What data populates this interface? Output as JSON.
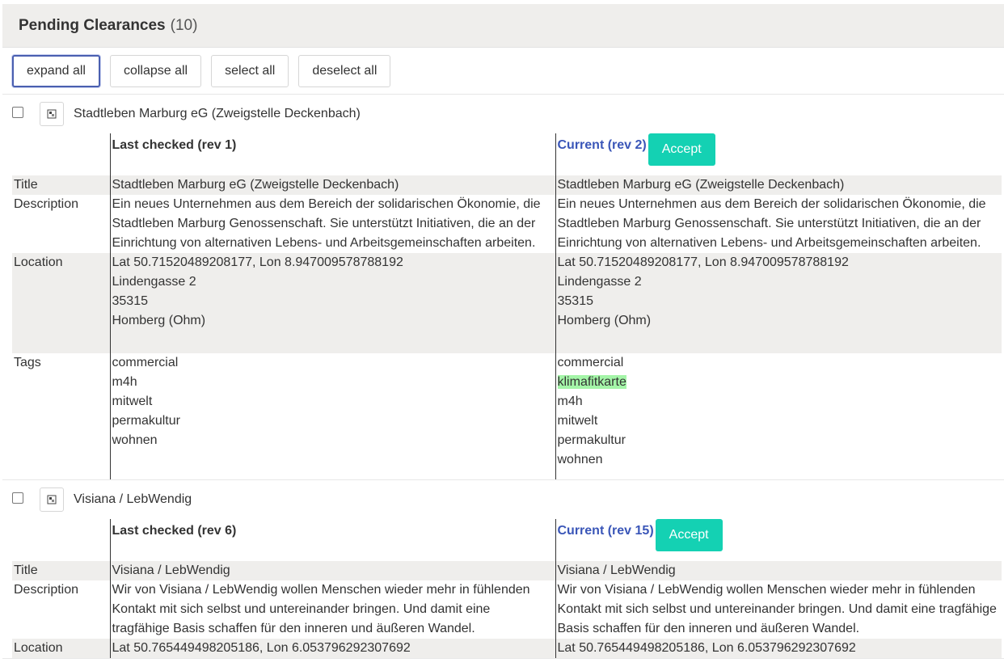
{
  "header": {
    "title": "Pending Clearances",
    "count": "(10)"
  },
  "toolbar": {
    "expand_all": "expand all",
    "collapse_all": "collapse all",
    "select_all": "select all",
    "deselect_all": "deselect all"
  },
  "entries": [
    {
      "title": "Stadtleben Marburg eG (Zweigstelle Deckenbach)",
      "old_rev": "Last checked (rev 1)",
      "new_rev": "Current (rev 2)",
      "accept": "Accept",
      "labels": {
        "title": "Title",
        "description": "Description",
        "location": "Location",
        "tags": "Tags"
      },
      "old": {
        "title": "Stadtleben Marburg eG (Zweigstelle Deckenbach)",
        "description": [
          "Ein neues Unternehmen aus dem Bereich der solidarischen Ökonomie, die",
          "Stadtleben Marburg Genossenschaft. Sie unterstützt Initiativen, die an der",
          "Einrichtung von alternativen Lebens- und Arbeitsgemeinschaften arbeiten."
        ],
        "location": [
          "Lat 50.71520489208177, Lon 8.947009578788192",
          "Lindengasse 2",
          "35315",
          "Homberg (Ohm)"
        ],
        "tags": [
          "commercial",
          "m4h",
          "mitwelt",
          "permakultur",
          "wohnen"
        ]
      },
      "new": {
        "title": "Stadtleben Marburg eG (Zweigstelle Deckenbach)",
        "description": [
          "Ein neues Unternehmen aus dem Bereich der solidarischen Ökonomie, die",
          "Stadtleben Marburg Genossenschaft. Sie unterstützt Initiativen, die an der",
          "Einrichtung von alternativen Lebens- und Arbeitsgemeinschaften arbeiten."
        ],
        "location": [
          "Lat 50.71520489208177, Lon 8.947009578788192",
          "Lindengasse 2",
          "35315",
          "Homberg (Ohm)"
        ],
        "tags": [
          "commercial",
          "klimafitkarte",
          "m4h",
          "mitwelt",
          "permakultur",
          "wohnen"
        ],
        "added_tag": "klimafitkarte"
      }
    },
    {
      "title": "Visiana / LebWendig",
      "old_rev": "Last checked (rev 6)",
      "new_rev": "Current (rev 15)",
      "accept": "Accept",
      "labels": {
        "title": "Title",
        "description": "Description",
        "location": "Location"
      },
      "old": {
        "title": "Visiana / LebWendig",
        "description": [
          "Wir von Visiana / LebWendig wollen Menschen wieder mehr in fühlenden",
          "Kontakt mit sich selbst und untereinander bringen. Und damit eine",
          "tragfähige Basis schaffen für den inneren und äußeren Wandel."
        ],
        "location": [
          "Lat 50.765449498205186, Lon 6.053796292307692"
        ]
      },
      "new": {
        "title": "Visiana / LebWendig",
        "description": [
          "Wir von Visiana / LebWendig wollen Menschen wieder mehr in fühlenden",
          "Kontakt mit sich selbst und untereinander bringen. Und damit eine tragfähige",
          "Basis schaffen für den inneren und äußeren Wandel."
        ],
        "location": [
          "Lat 50.765449498205186, Lon 6.053796292307692"
        ]
      }
    }
  ]
}
